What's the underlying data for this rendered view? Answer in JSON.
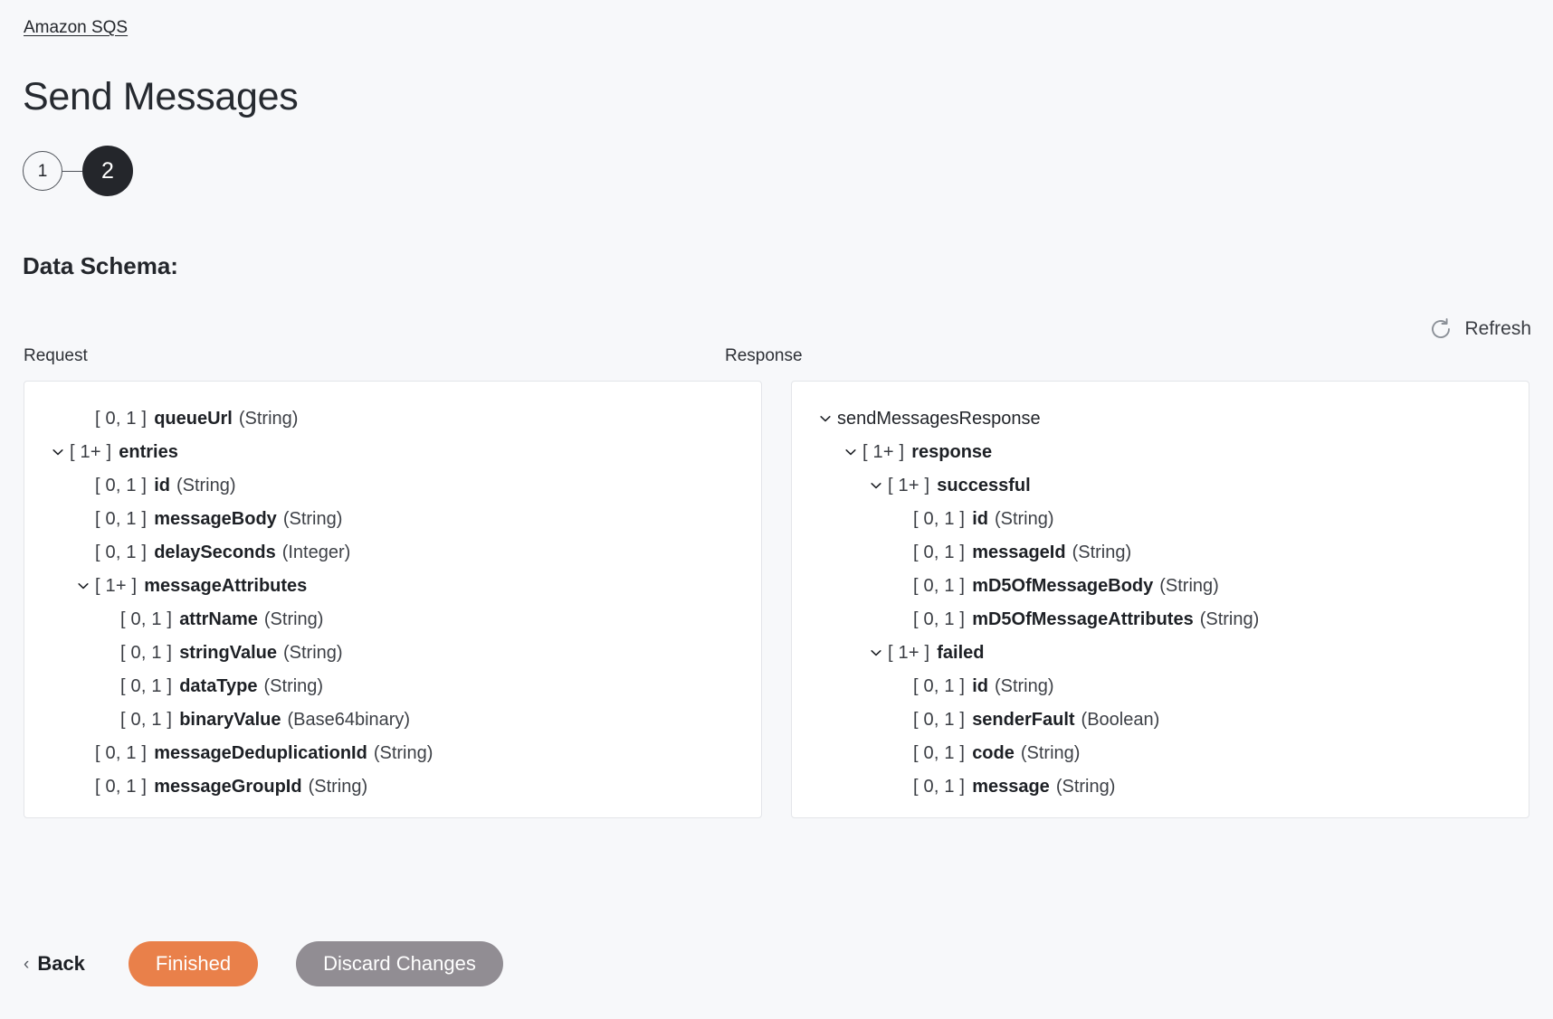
{
  "breadcrumb": {
    "label": "Amazon SQS"
  },
  "page": {
    "title": "Send Messages"
  },
  "stepper": {
    "steps": [
      {
        "label": "1",
        "state": "inactive"
      },
      {
        "label": "2",
        "state": "active"
      }
    ]
  },
  "section": {
    "heading": "Data Schema:"
  },
  "toolbar": {
    "refresh_label": "Refresh",
    "refresh_icon": "refresh-icon"
  },
  "panels": {
    "request": {
      "label": "Request",
      "nodes": [
        {
          "indent": 2,
          "twisty": "none",
          "card": "[ 0, 1 ]",
          "name": "queueUrl",
          "type": "(String)",
          "bold": true
        },
        {
          "indent": 1,
          "twisty": "down",
          "card": "[ 1+ ]",
          "name": "entries",
          "type": "",
          "bold": true
        },
        {
          "indent": 2,
          "twisty": "none",
          "card": "[ 0, 1 ]",
          "name": "id",
          "type": "(String)",
          "bold": true
        },
        {
          "indent": 2,
          "twisty": "none",
          "card": "[ 0, 1 ]",
          "name": "messageBody",
          "type": "(String)",
          "bold": true
        },
        {
          "indent": 2,
          "twisty": "none",
          "card": "[ 0, 1 ]",
          "name": "delaySeconds",
          "type": "(Integer)",
          "bold": true
        },
        {
          "indent": 2,
          "twisty": "down",
          "card": "[ 1+ ]",
          "name": "messageAttributes",
          "type": "",
          "bold": true
        },
        {
          "indent": 3,
          "twisty": "none",
          "card": "[ 0, 1 ]",
          "name": "attrName",
          "type": "(String)",
          "bold": true
        },
        {
          "indent": 3,
          "twisty": "none",
          "card": "[ 0, 1 ]",
          "name": "stringValue",
          "type": "(String)",
          "bold": true
        },
        {
          "indent": 3,
          "twisty": "none",
          "card": "[ 0, 1 ]",
          "name": "dataType",
          "type": "(String)",
          "bold": true
        },
        {
          "indent": 3,
          "twisty": "none",
          "card": "[ 0, 1 ]",
          "name": "binaryValue",
          "type": "(Base64binary)",
          "bold": true
        },
        {
          "indent": 2,
          "twisty": "none",
          "card": "[ 0, 1 ]",
          "name": "messageDeduplicationId",
          "type": "(String)",
          "bold": true
        },
        {
          "indent": 2,
          "twisty": "none",
          "card": "[ 0, 1 ]",
          "name": "messageGroupId",
          "type": "(String)",
          "bold": true
        }
      ]
    },
    "response": {
      "label": "Response",
      "nodes": [
        {
          "indent": 1,
          "twisty": "down",
          "card": "",
          "name": "sendMessagesResponse",
          "type": "",
          "bold": false
        },
        {
          "indent": 2,
          "twisty": "down",
          "card": "[ 1+ ]",
          "name": "response",
          "type": "",
          "bold": true
        },
        {
          "indent": 3,
          "twisty": "down",
          "card": "[ 1+ ]",
          "name": "successful",
          "type": "",
          "bold": true
        },
        {
          "indent": 4,
          "twisty": "none",
          "card": "[ 0, 1 ]",
          "name": "id",
          "type": "(String)",
          "bold": true
        },
        {
          "indent": 4,
          "twisty": "none",
          "card": "[ 0, 1 ]",
          "name": "messageId",
          "type": "(String)",
          "bold": true
        },
        {
          "indent": 4,
          "twisty": "none",
          "card": "[ 0, 1 ]",
          "name": "mD5OfMessageBody",
          "type": "(String)",
          "bold": true
        },
        {
          "indent": 4,
          "twisty": "none",
          "card": "[ 0, 1 ]",
          "name": "mD5OfMessageAttributes",
          "type": "(String)",
          "bold": true
        },
        {
          "indent": 3,
          "twisty": "down",
          "card": "[ 1+ ]",
          "name": "failed",
          "type": "",
          "bold": true
        },
        {
          "indent": 4,
          "twisty": "none",
          "card": "[ 0, 1 ]",
          "name": "id",
          "type": "(String)",
          "bold": true
        },
        {
          "indent": 4,
          "twisty": "none",
          "card": "[ 0, 1 ]",
          "name": "senderFault",
          "type": "(Boolean)",
          "bold": true
        },
        {
          "indent": 4,
          "twisty": "none",
          "card": "[ 0, 1 ]",
          "name": "code",
          "type": "(String)",
          "bold": true
        },
        {
          "indent": 4,
          "twisty": "none",
          "card": "[ 0, 1 ]",
          "name": "message",
          "type": "(String)",
          "bold": true
        }
      ]
    }
  },
  "footer": {
    "back_label": "Back",
    "finished_label": "Finished",
    "discard_label": "Discard Changes"
  },
  "colors": {
    "accent_orange": "#e9804a",
    "secondary_grey": "#918d93",
    "step_active": "#24262b",
    "background": "#f7f8fa",
    "panel": "#ffffff"
  }
}
